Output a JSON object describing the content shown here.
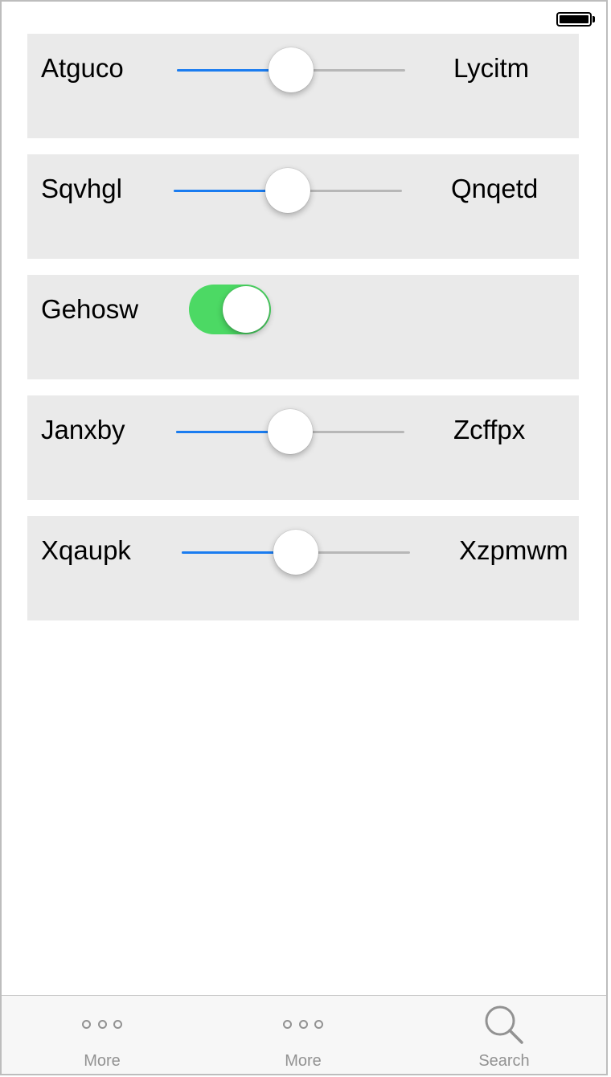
{
  "rows": [
    {
      "type": "slider",
      "label": "Atguco",
      "right_label": "Lycitm",
      "value_fraction": 0.5
    },
    {
      "type": "slider",
      "label": "Sqvhgl",
      "right_label": "Qnqetd",
      "value_fraction": 0.5
    },
    {
      "type": "toggle",
      "label": "Gehosw",
      "on": true
    },
    {
      "type": "slider",
      "label": "Janxby",
      "right_label": "Zcffpx",
      "value_fraction": 0.5
    },
    {
      "type": "slider",
      "label": "Xqaupk",
      "right_label": "Xzpmwm",
      "value_fraction": 0.5
    }
  ],
  "tab_bar": {
    "tabs": [
      {
        "label": "More",
        "icon": "more-icon"
      },
      {
        "label": "More",
        "icon": "more-icon"
      },
      {
        "label": "Search",
        "icon": "search-icon"
      }
    ]
  },
  "colors": {
    "slider_fill": "#1a7cf0",
    "slider_track": "#b7b7b7",
    "toggle_on": "#4cd964",
    "row_background": "#eaeaea",
    "tab_inactive": "#929292"
  },
  "status_bar": {
    "battery_icon": "battery-full-icon"
  }
}
